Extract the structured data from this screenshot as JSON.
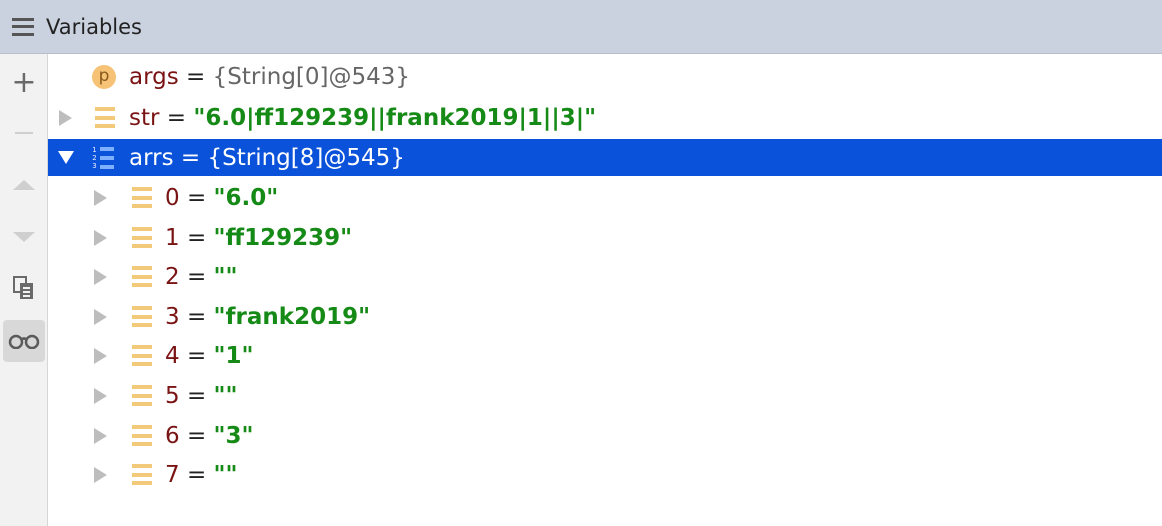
{
  "panel": {
    "title": "Variables",
    "icon": "menu-icon"
  },
  "toolbar": {
    "add_symbol": "+",
    "buttons": [
      "add-icon",
      "remove-icon",
      "move-up-icon",
      "move-down-icon",
      "copy-icon",
      "watch-glasses-icon"
    ]
  },
  "colors": {
    "selection": "#0b52db",
    "string_value": "#168a16",
    "var_name": "#7a1414",
    "header_bg": "#c9d2de"
  },
  "variables": [
    {
      "name": "args",
      "eq": "=",
      "value": "{String[0]@543}",
      "icon": "parameter-icon",
      "icon_letter": "p",
      "expanded": false
    },
    {
      "name": "str",
      "eq": "=",
      "value": "\"6.0|ff129239||frank2019|1||3|\"",
      "icon": "field-icon",
      "expanded": false
    },
    {
      "name": "arrs",
      "eq": "=",
      "value": "{String[8]@545}",
      "icon": "array-icon",
      "icon_digits": [
        "1",
        "2",
        "3"
      ],
      "expanded": true,
      "selected": true
    }
  ],
  "array_items": [
    {
      "index": "0",
      "eq": "=",
      "value": "\"6.0\""
    },
    {
      "index": "1",
      "eq": "=",
      "value": "\"ff129239\""
    },
    {
      "index": "2",
      "eq": "=",
      "value": "\"\""
    },
    {
      "index": "3",
      "eq": "=",
      "value": "\"frank2019\""
    },
    {
      "index": "4",
      "eq": "=",
      "value": "\"1\""
    },
    {
      "index": "5",
      "eq": "=",
      "value": "\"\""
    },
    {
      "index": "6",
      "eq": "=",
      "value": "\"3\""
    },
    {
      "index": "7",
      "eq": "=",
      "value": "\"\""
    }
  ]
}
